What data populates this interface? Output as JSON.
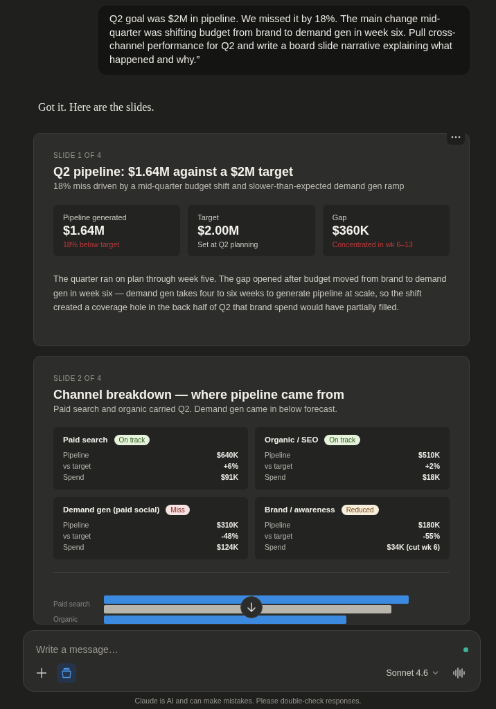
{
  "user_message": "Q2 goal was $2M in pipeline. We missed it by 18%. The main change mid-quarter was shifting budget from brand to demand gen in week six. Pull cross-channel performance for Q2 and write a board slide narrative explaining what happened and why.”",
  "reply_intro": "Got it. Here are the slides.",
  "slides": [
    {
      "eyebrow": "SLIDE 1 OF 4",
      "title": "Q2 pipeline: $1.64M against a $2M target",
      "subtitle": "18% miss driven by a mid-quarter budget shift and slower-than-expected demand gen ramp",
      "metrics": [
        {
          "label": "Pipeline generated",
          "value": "$1.64M",
          "note": "18% below target",
          "kind": "negative"
        },
        {
          "label": "Target",
          "value": "$2.00M",
          "note": "Set at Q2 planning",
          "kind": "neutral"
        },
        {
          "label": "Gap",
          "value": "$360K",
          "note": "Concentrated in wk 6–13",
          "kind": "negative"
        }
      ],
      "narrative": "The quarter ran on plan through week five. The gap opened after budget moved from brand to demand gen in week six — demand gen takes four to six weeks to generate pipeline at scale, so the shift created a coverage hole in the back half of Q2 that brand spend would have partially filled."
    },
    {
      "eyebrow": "SLIDE 2 OF 4",
      "title": "Channel breakdown — where pipeline came from",
      "subtitle": "Paid search and organic carried Q2. Demand gen came in below forecast.",
      "channels": [
        {
          "name": "Paid search",
          "badge": "On track",
          "kind": "good",
          "rows": [
            [
              "Pipeline",
              "$640K"
            ],
            [
              "vs target",
              "+6%"
            ],
            [
              "Spend",
              "$91K"
            ]
          ]
        },
        {
          "name": "Organic / SEO",
          "badge": "On track",
          "kind": "good",
          "rows": [
            [
              "Pipeline",
              "$510K"
            ],
            [
              "vs target",
              "+2%"
            ],
            [
              "Spend",
              "$18K"
            ]
          ]
        },
        {
          "name": "Demand gen (paid social)",
          "badge": "Miss",
          "kind": "bad",
          "rows": [
            [
              "Pipeline",
              "$310K"
            ],
            [
              "vs target",
              "-48%"
            ],
            [
              "Spend",
              "$124K"
            ]
          ]
        },
        {
          "name": "Brand / awareness",
          "badge": "Reduced",
          "kind": "warn",
          "rows": [
            [
              "Pipeline",
              "$180K"
            ],
            [
              "vs target",
              "-55%"
            ],
            [
              "Spend",
              "$34K (cut wk 6)"
            ]
          ]
        }
      ],
      "chart_labels": [
        "Paid search",
        "Organic"
      ]
    }
  ],
  "composer": {
    "placeholder": "Write a message…",
    "model": "Sonnet 4.6"
  },
  "disclaimer": "Claude is AI and can make mistakes. Please double-check responses."
}
